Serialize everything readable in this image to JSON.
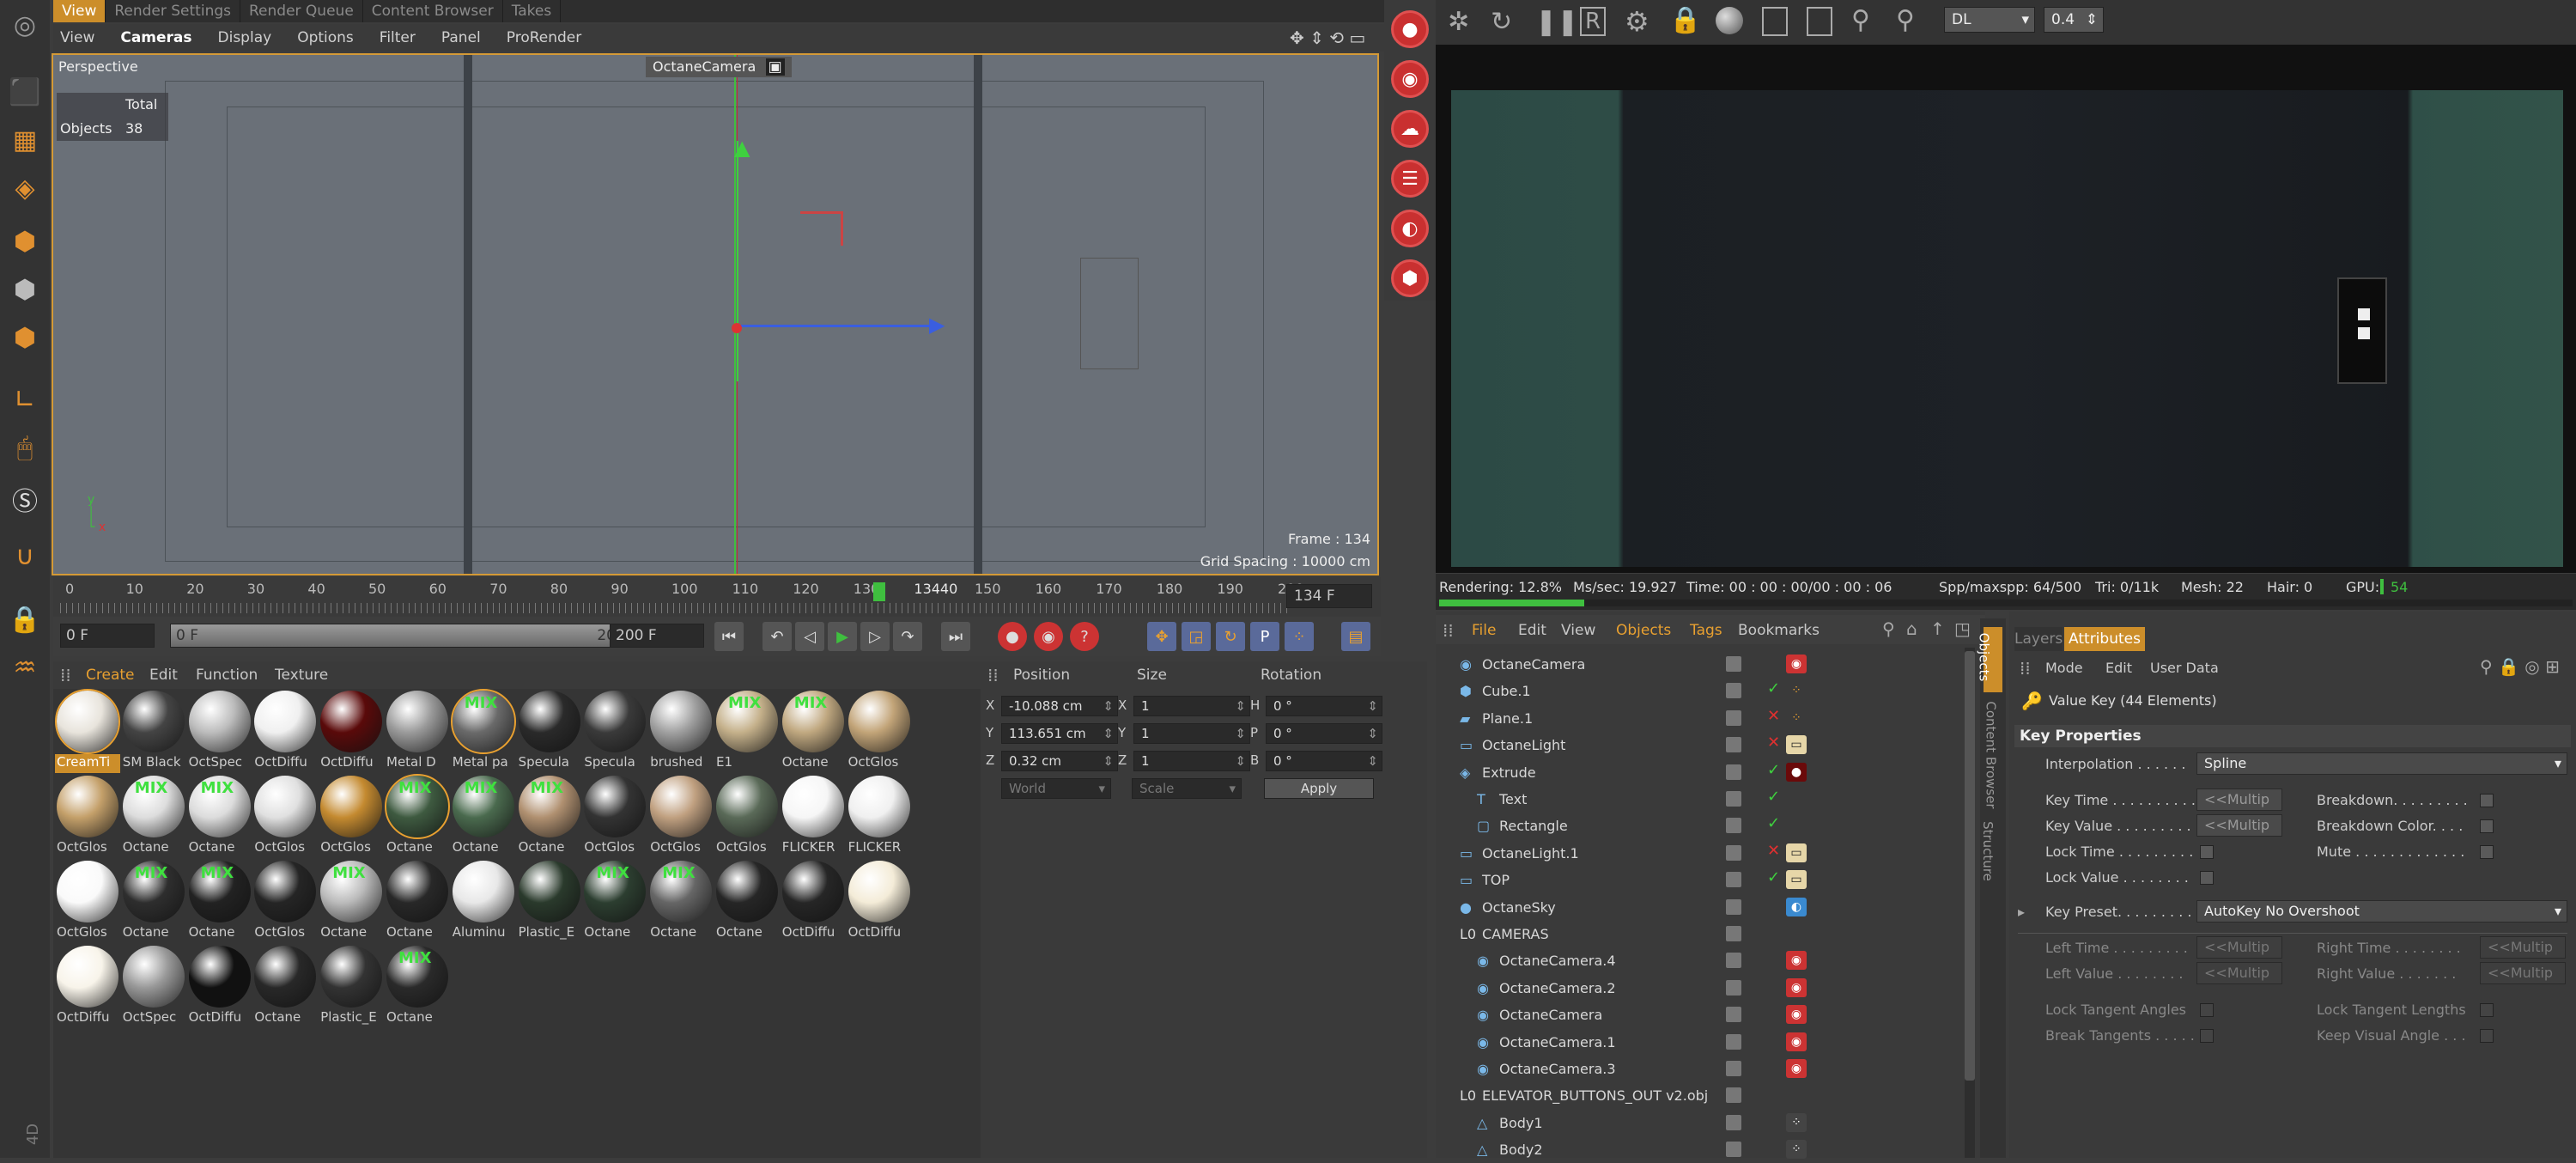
{
  "top_tabs": [
    "View",
    "Render Settings",
    "Render Queue",
    "Content Browser",
    "Takes"
  ],
  "viewport_menu": [
    "View",
    "Cameras",
    "Display",
    "Options",
    "Filter",
    "Panel",
    "ProRender"
  ],
  "viewport": {
    "name": "Perspective",
    "camera": "OctaneCamera",
    "total_label": "Total",
    "objects_label": "Objects",
    "objects_count": "38",
    "frame": "Frame : 134",
    "grid_spacing": "Grid Spacing : 10000 cm"
  },
  "timeline": {
    "ticks": [
      "0",
      "10",
      "20",
      "30",
      "40",
      "50",
      "60",
      "70",
      "80",
      "90",
      "100",
      "110",
      "120",
      "130",
      "13440",
      "150",
      "160",
      "170",
      "180",
      "190",
      "200"
    ],
    "current_frame": "134 F",
    "start_field": "0 F",
    "range_start": "0 F",
    "range_end": "200 F",
    "end_field": "200 F"
  },
  "material_menu": [
    "Create",
    "Edit",
    "Function",
    "Texture"
  ],
  "materials": [
    {
      "name": "CreamTi",
      "color": "#e8e4dc",
      "mix": false,
      "sel": true
    },
    {
      "name": "SM Black",
      "color": "#444",
      "mix": false
    },
    {
      "name": "OctSpec",
      "color": "#bcbcbc",
      "mix": false
    },
    {
      "name": "OctDiffu",
      "color": "#f0f0f0",
      "mix": false
    },
    {
      "name": "OctDiffu",
      "color": "#5a0a0a",
      "mix": false
    },
    {
      "name": "Metal D",
      "color": "#9a9a9a",
      "mix": false
    },
    {
      "name": "Metal pa",
      "color": "#6a6a6a",
      "mix": true,
      "sel": true
    },
    {
      "name": "Specula",
      "color": "#2a2a2a",
      "mix": false
    },
    {
      "name": "Specula",
      "color": "#3a3a3a",
      "mix": false
    },
    {
      "name": "brushed",
      "color": "#a0a0a0",
      "mix": false
    },
    {
      "name": "E1",
      "color": "#c4b08a",
      "mix": true
    },
    {
      "name": "Octane",
      "color": "#c0a880",
      "mix": true
    },
    {
      "name": "OctGlos",
      "color": "#c2a478",
      "mix": false
    },
    {
      "name": "OctGlos",
      "color": "#c4a06a",
      "mix": false
    },
    {
      "name": "Octane",
      "color": "#ddd",
      "mix": true
    },
    {
      "name": "Octane",
      "color": "#dcdcdc",
      "mix": true
    },
    {
      "name": "OctGlos",
      "color": "#e0e0e0",
      "mix": false
    },
    {
      "name": "OctGlos",
      "color": "#c48a30",
      "mix": false
    },
    {
      "name": "Octane",
      "color": "#3e5a40",
      "mix": true,
      "sel": true
    },
    {
      "name": "Octane",
      "color": "#4a6a4e",
      "mix": true
    },
    {
      "name": "Octane",
      "color": "#b09070",
      "mix": true
    },
    {
      "name": "OctGlos",
      "color": "#333",
      "mix": false
    },
    {
      "name": "OctGlos",
      "color": "#c0a080",
      "mix": false
    },
    {
      "name": "OctGlos",
      "color": "#5a6a58",
      "mix": false
    },
    {
      "name": "FLICKER",
      "color": "#f6f6f6",
      "mix": false
    },
    {
      "name": "FLICKER",
      "color": "#f0f0f0",
      "mix": false
    },
    {
      "name": "OctGlos",
      "color": "#fafafa",
      "mix": false
    },
    {
      "name": "Octane",
      "color": "#2e2e2e",
      "mix": true
    },
    {
      "name": "Octane",
      "color": "#222",
      "mix": true
    },
    {
      "name": "OctGlos",
      "color": "#252525",
      "mix": false
    },
    {
      "name": "Octane",
      "color": "#bbb",
      "mix": true
    },
    {
      "name": "Octane",
      "color": "#282828",
      "mix": false
    },
    {
      "name": "Aluminu",
      "color": "#e8e8e8",
      "mix": false
    },
    {
      "name": "Plastic_E",
      "color": "#2a3a2c",
      "mix": false
    },
    {
      "name": "Octane",
      "color": "#2c3e30",
      "mix": true
    },
    {
      "name": "Octane",
      "color": "#666",
      "mix": true
    },
    {
      "name": "Octane",
      "color": "#262626",
      "mix": false
    },
    {
      "name": "OctDiffu",
      "color": "#262626",
      "mix": false
    },
    {
      "name": "OctDiffu",
      "color": "#f4ecd8",
      "mix": false
    },
    {
      "name": "OctDiffu",
      "color": "#f8f4ea",
      "mix": false
    },
    {
      "name": "OctSpec",
      "color": "#999",
      "mix": false
    },
    {
      "name": "OctDiffu",
      "color": "#111",
      "mix": false
    },
    {
      "name": "Octane",
      "color": "#282828",
      "mix": false
    },
    {
      "name": "Plastic_E",
      "color": "#333",
      "mix": false
    },
    {
      "name": "Octane",
      "color": "#2a2a2a",
      "mix": true
    }
  ],
  "coords": {
    "headers": [
      "Position",
      "Size",
      "Rotation"
    ],
    "pos": [
      {
        "axis": "X",
        "val": "-10.088 cm"
      },
      {
        "axis": "Y",
        "val": "113.651 cm"
      },
      {
        "axis": "Z",
        "val": "0.32 cm"
      }
    ],
    "size": [
      {
        "axis": "X",
        "val": "1"
      },
      {
        "axis": "Y",
        "val": "1"
      },
      {
        "axis": "Z",
        "val": "1"
      }
    ],
    "rot": [
      {
        "axis": "H",
        "val": "0 °"
      },
      {
        "axis": "P",
        "val": "0 °"
      },
      {
        "axis": "B",
        "val": "0 °"
      }
    ],
    "mode": "World",
    "size_mode": "Scale",
    "apply": "Apply"
  },
  "render_toolbar": {
    "mode": "DL",
    "value": "0.4"
  },
  "render_status": {
    "rendering": "Rendering: 12.8%",
    "ms": "Ms/sec: 19.927",
    "time": "Time: 00 : 00 : 00/00 : 00 : 06",
    "spp": "Spp/maxspp: 64/500",
    "tri": "Tri: 0/11k",
    "mesh": "Mesh: 22",
    "hair": "Hair: 0",
    "gpu": "GPU:",
    "gpu_val": "54",
    "progress": 0.128
  },
  "object_menu": [
    "File",
    "Edit",
    "View",
    "Objects",
    "Tags",
    "Bookmarks"
  ],
  "objects": [
    {
      "name": "OctaneCamera",
      "indent": 0,
      "icon": "camera",
      "check": "",
      "tag": "cam"
    },
    {
      "name": "Cube.1",
      "indent": 0,
      "icon": "cube",
      "check": "✓",
      "tag": "dots"
    },
    {
      "name": "Plane.1",
      "indent": 0,
      "icon": "plane",
      "check": "✕",
      "tag": "dots"
    },
    {
      "name": "OctaneLight",
      "indent": 0,
      "icon": "light",
      "check": "✕",
      "tag": "light"
    },
    {
      "name": "Extrude",
      "indent": 0,
      "icon": "extrude",
      "check": "✓",
      "tag": "mat"
    },
    {
      "name": "Text",
      "indent": 1,
      "icon": "text",
      "check": "✓",
      "tag": ""
    },
    {
      "name": "Rectangle",
      "indent": 1,
      "icon": "rect",
      "check": "✓",
      "tag": ""
    },
    {
      "name": "OctaneLight.1",
      "indent": 0,
      "icon": "light",
      "check": "✕",
      "tag": "light"
    },
    {
      "name": "TOP",
      "indent": 0,
      "icon": "light",
      "check": "✓",
      "tag": "light"
    },
    {
      "name": "OctaneSky",
      "indent": 0,
      "icon": "sky",
      "check": "",
      "tag": "sky"
    },
    {
      "name": "CAMERAS",
      "indent": 0,
      "icon": "null",
      "check": "",
      "tag": ""
    },
    {
      "name": "OctaneCamera.4",
      "indent": 1,
      "icon": "camera",
      "check": "",
      "tag": "cam"
    },
    {
      "name": "OctaneCamera.2",
      "indent": 1,
      "icon": "camera",
      "check": "",
      "tag": "cam"
    },
    {
      "name": "OctaneCamera",
      "indent": 1,
      "icon": "camera",
      "check": "",
      "tag": "cam"
    },
    {
      "name": "OctaneCamera.1",
      "indent": 1,
      "icon": "camera",
      "check": "",
      "tag": "cam"
    },
    {
      "name": "OctaneCamera.3",
      "indent": 1,
      "icon": "camera",
      "check": "",
      "tag": "cam"
    },
    {
      "name": "ELEVATOR_BUTTONS_OUT v2.obj",
      "indent": 0,
      "icon": "null",
      "check": "",
      "tag": ""
    },
    {
      "name": "Body1",
      "indent": 1,
      "icon": "poly",
      "check": "",
      "tag": "multi"
    },
    {
      "name": "Body2",
      "indent": 1,
      "icon": "poly",
      "check": "",
      "tag": "multi"
    }
  ],
  "side_tabs": [
    "Objects",
    "Content Browser",
    "Structure"
  ],
  "attr_tabs": [
    "Layers",
    "Attributes"
  ],
  "attr_menu": [
    "Mode",
    "Edit",
    "User Data"
  ],
  "attr_title": "Value Key (44 Elements)",
  "attr_section": "Key Properties",
  "attr": {
    "interpolation_label": "Interpolation . . . . . .",
    "interpolation_val": "Spline",
    "key_time": "Key Time . . . . . . . . . .",
    "key_time_val": "<<Multip",
    "key_value": "Key Value . . . . . . . . .",
    "key_value_val": "<<Multip",
    "lock_time": "Lock Time . . . . . . . . .",
    "lock_value": "Lock Value . . . . . . . .",
    "breakdown": "Breakdown. . . . . . . . .",
    "breakdown_color": "Breakdown Color. . . .",
    "mute": "Mute . . . . . . . . . . . . .",
    "key_preset": "Key Preset. . . . . . . . .",
    "key_preset_val": "AutoKey No Overshoot",
    "left_time": "Left Time . . . . . . . . .",
    "left_value": "Left Value . . . . . . . .",
    "right_time": "Right Time . . . . . . . .",
    "right_value": "Right Value . . . . . . .",
    "multi": "<<Multip",
    "lock_tangent_angles": "Lock Tangent Angles",
    "lock_tangent_lengths": "Lock Tangent Lengths",
    "break_tangents": "Break Tangents . . . . .",
    "keep_visual_angle": "Keep Visual Angle . . ."
  },
  "brand_vertical": "4D"
}
